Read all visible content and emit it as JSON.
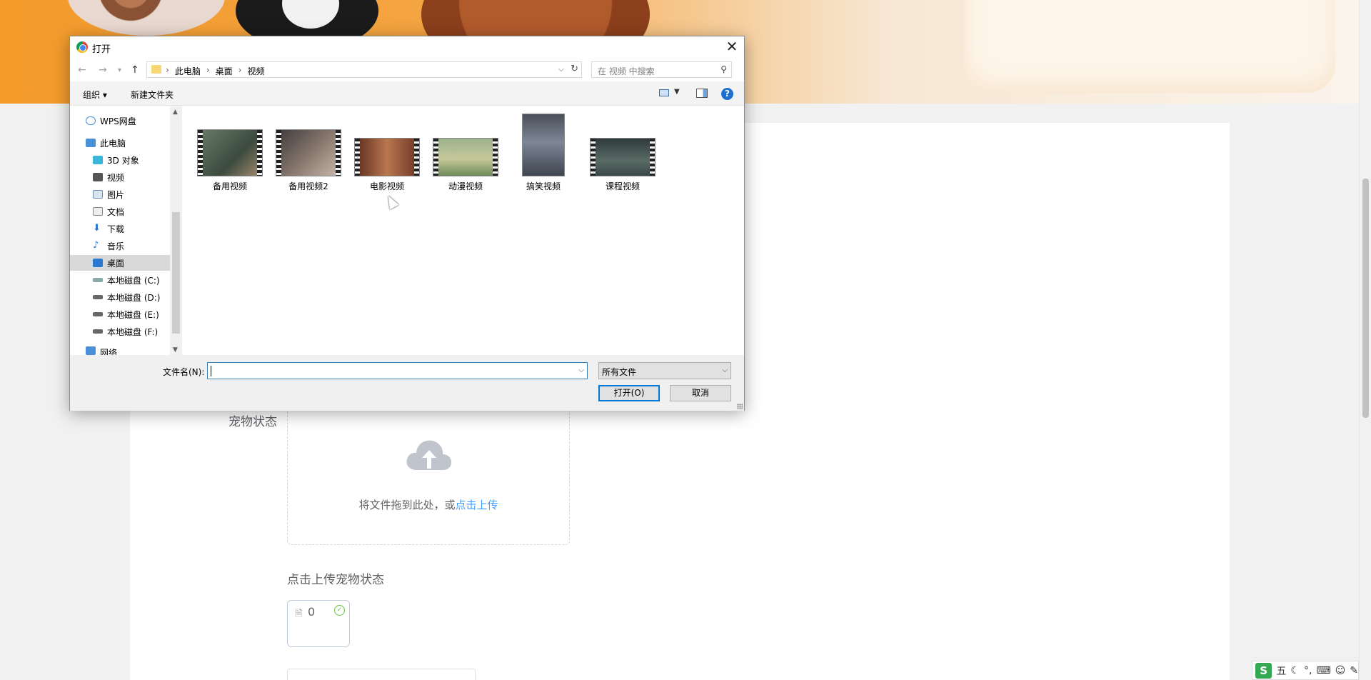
{
  "page": {
    "form_label": "宠物状态",
    "upload_text": "将文件拖到此处，或",
    "upload_link": "点击上传",
    "upload_tip": "点击上传宠物状态",
    "file_name": "0"
  },
  "ime": {
    "logo": "S",
    "mode": "五"
  },
  "dialog": {
    "title": "打开",
    "close": "✕",
    "nav": {
      "back": "←",
      "forward": "→",
      "up": "↑"
    },
    "breadcrumb": [
      "此电脑",
      "桌面",
      "视频"
    ],
    "search_placeholder": "在 视频 中搜索",
    "toolbar": {
      "organize": "组织 ▾",
      "new_folder": "新建文件夹",
      "help": "?"
    },
    "sidebar": [
      {
        "label": "WPS网盘",
        "icon": "cloud-icon",
        "selected": false
      },
      {
        "label": "此电脑",
        "icon": "computer-icon",
        "selected": false
      },
      {
        "label": "3D 对象",
        "icon": "3d-objects-icon",
        "selected": false
      },
      {
        "label": "视频",
        "icon": "video-icon",
        "selected": false
      },
      {
        "label": "图片",
        "icon": "pictures-icon",
        "selected": false
      },
      {
        "label": "文档",
        "icon": "documents-icon",
        "selected": false
      },
      {
        "label": "下载",
        "icon": "download-icon",
        "selected": false
      },
      {
        "label": "音乐",
        "icon": "music-icon",
        "selected": false
      },
      {
        "label": "桌面",
        "icon": "desktop-icon",
        "selected": true
      },
      {
        "label": "本地磁盘 (C:)",
        "icon": "drive-icon",
        "selected": false
      },
      {
        "label": "本地磁盘 (D:)",
        "icon": "drive-icon",
        "selected": false
      },
      {
        "label": "本地磁盘 (E:)",
        "icon": "drive-icon",
        "selected": false
      },
      {
        "label": "本地磁盘 (F:)",
        "icon": "drive-icon",
        "selected": false
      },
      {
        "label": "网络",
        "icon": "network-icon",
        "selected": false
      }
    ],
    "files": [
      {
        "name": "备用视频",
        "thumb": "video-thumbnail"
      },
      {
        "name": "备用视频2",
        "thumb": "video-thumbnail"
      },
      {
        "name": "电影视频",
        "thumb": "video-thumbnail"
      },
      {
        "name": "动漫视频",
        "thumb": "video-thumbnail"
      },
      {
        "name": "搞笑视频",
        "thumb": "video-thumbnail"
      },
      {
        "name": "课程视频",
        "thumb": "video-thumbnail"
      }
    ],
    "filename_label": "文件名(N):",
    "filename_value": "",
    "filter_value": "所有文件",
    "open_button": "打开(O)",
    "cancel_button": "取消"
  },
  "colors": {
    "accent": "#0078d7",
    "link": "#409eff",
    "banner": "#f39a2a"
  }
}
